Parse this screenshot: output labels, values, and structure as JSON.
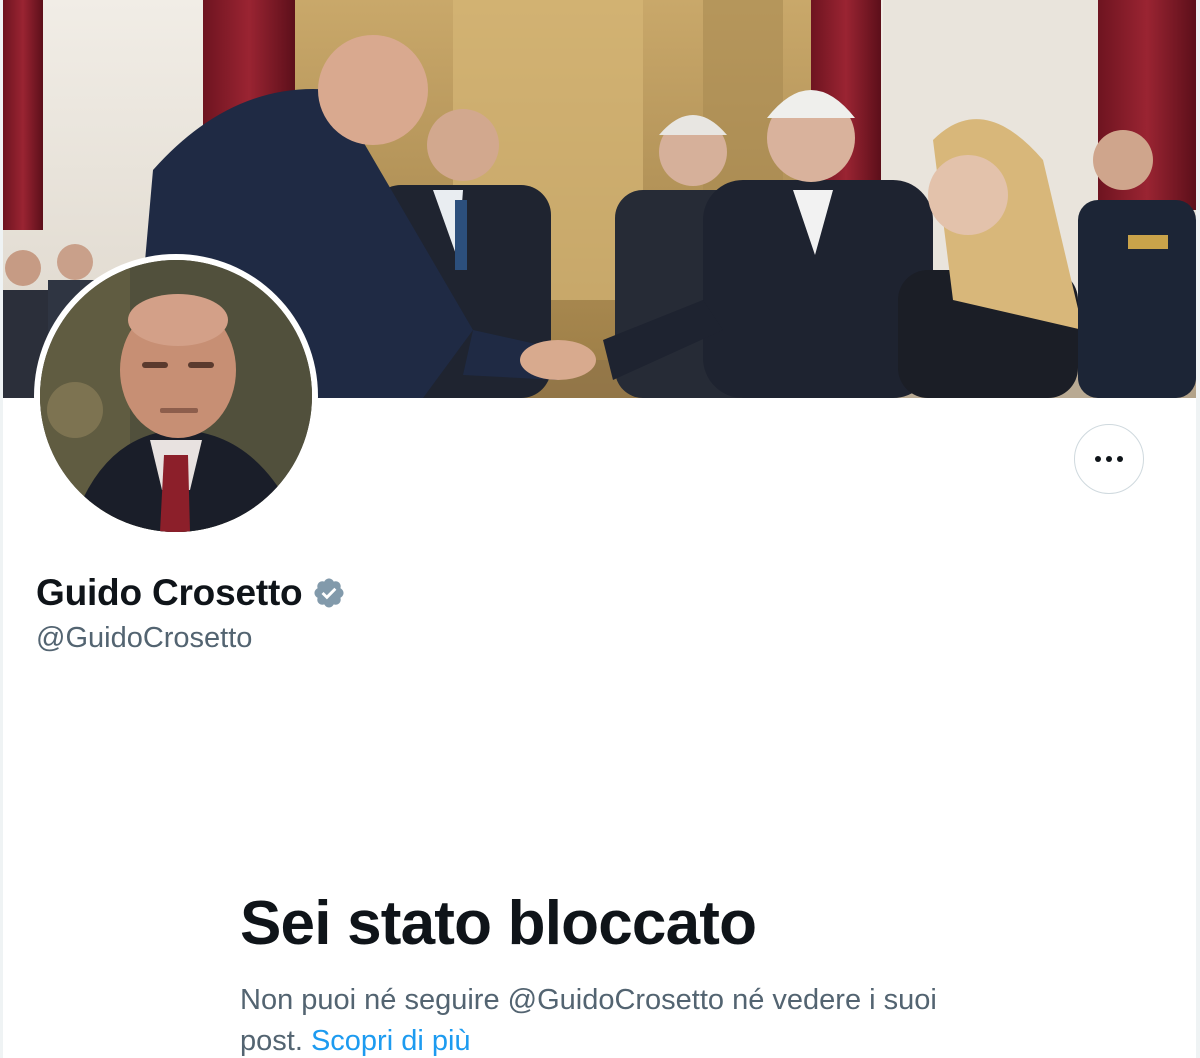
{
  "profile": {
    "display_name": "Guido Crosetto",
    "handle": "@GuidoCrosetto",
    "verified": true,
    "verified_badge_color": "#829aab"
  },
  "actions": {
    "more_icon": "more-horizontal-icon"
  },
  "blocked": {
    "title": "Sei stato bloccato",
    "description": "Non puoi né seguire @GuidoCrosetto né vedere i suoi post.",
    "learn_more_label": "Scopri di più",
    "link_color": "#1d9bf0"
  }
}
